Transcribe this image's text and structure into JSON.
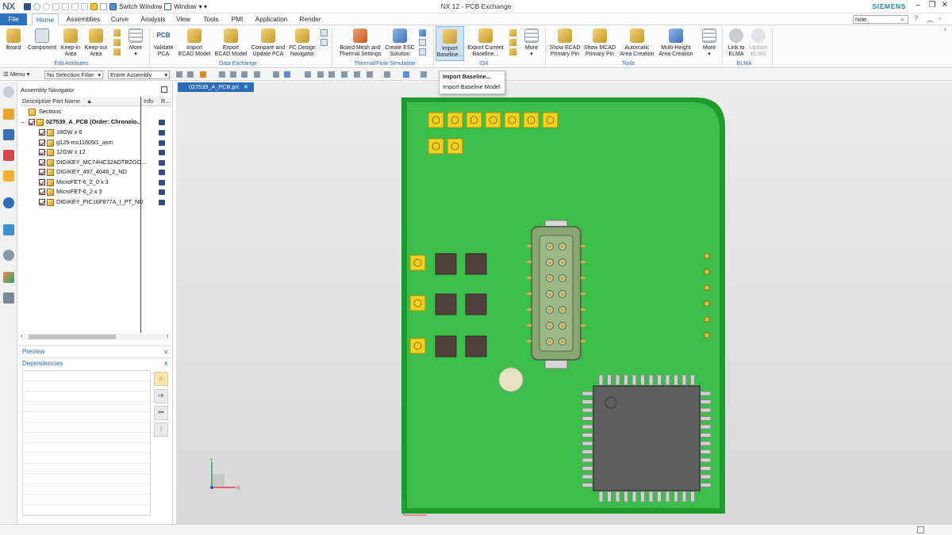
{
  "app": {
    "logo": "NX",
    "window_title": "NX 12 - PCB Exchange",
    "brand": "SIEMENS",
    "switch_window": "Switch Window",
    "window_menu": "Window"
  },
  "menu": {
    "tabs": [
      "File",
      "Home",
      "Assemblies",
      "Curve",
      "Analysis",
      "View",
      "Tools",
      "PMI",
      "Application",
      "Render"
    ],
    "active": "Home",
    "search_value": "hole"
  },
  "ribbon": {
    "edit_attributes": {
      "group": "Edit Attributes",
      "board": "Board",
      "component": "Component",
      "keepin": [
        "Keep-in",
        "Area"
      ],
      "keepout": [
        "Keep-out",
        "Area"
      ],
      "more": "More"
    },
    "data_exchange": {
      "group": "Data Exchange",
      "validate": [
        "Validate",
        "PCA"
      ],
      "import_ecad": [
        "Import",
        "ECAD Model"
      ],
      "export_ecad": [
        "Export",
        "ECAD Model"
      ],
      "compare": [
        "Compare and",
        "Update PCA"
      ],
      "pc_design": [
        "PC Design",
        "Navigator"
      ],
      "pcb_label": "PCB"
    },
    "thermal": {
      "group": "Thermal/Flow Simulation",
      "board_mesh": [
        "Board Mesh and",
        "Thermal Settings"
      ],
      "create_esc": [
        "Create ESC",
        "Solution"
      ]
    },
    "idx": {
      "group": "IDX",
      "import_baseline": [
        "Import",
        "Baseline..."
      ],
      "export_current": [
        "Export Current",
        "Baseline..."
      ],
      "more": "More"
    },
    "tools": {
      "group": "Tools",
      "show_ecad": [
        "Show ECAD",
        "Primary Pin"
      ],
      "show_mcad": [
        "Show MCAD",
        "Primary Pin"
      ],
      "automatic": [
        "Automatic",
        "Area Creation"
      ],
      "multi_height": [
        "Multi-Height",
        "Area Creation"
      ],
      "more": "More"
    },
    "elma": {
      "group": "ELMA",
      "link": [
        "Link to",
        "ELMA"
      ],
      "update": [
        "Update",
        "ELMA"
      ]
    }
  },
  "dropdown": {
    "items": [
      "Import Baseline...",
      "Import Baseline Model"
    ]
  },
  "toolbar2": {
    "menu": "Menu",
    "filter": "No Selection Filter",
    "scope": "Entire Assembly"
  },
  "navigator": {
    "title": "Assembly Navigator",
    "columns": {
      "name": "Descriptive Part Name",
      "info": "Info",
      "r": "R..."
    },
    "rows": [
      {
        "label": "Sections",
        "level": 0,
        "type": "folder"
      },
      {
        "label": "027539_A_PCB (Order: Chronolo...",
        "level": 0,
        "type": "assembly",
        "bold": true
      },
      {
        "label": "18GW x 6",
        "level": 1,
        "type": "part"
      },
      {
        "label": "g125-ms11605l1_asm",
        "level": 1,
        "type": "part"
      },
      {
        "label": "12GW x 12",
        "level": 1,
        "type": "part"
      },
      {
        "label": "DIGIKEY_MC74HC32ADTR2GO...",
        "level": 1,
        "type": "part"
      },
      {
        "label": "DIGIKEY_497_4048_2_ND",
        "level": 1,
        "type": "part"
      },
      {
        "label": "MicroFET-6_2_0 x 3",
        "level": 1,
        "type": "part"
      },
      {
        "label": "MicroFET-6_2 x 3",
        "level": 1,
        "type": "part"
      },
      {
        "label": "DIGIKEY_PIC16F877A_I_PT_ND",
        "level": 1,
        "type": "part"
      }
    ],
    "preview": "Preview",
    "dependencies": "Dependencies"
  },
  "viewport": {
    "doc_tab": "027539_A_PCB.prt",
    "axis_x": "X",
    "axis_y": "Y",
    "board_color": "#3cbf4a",
    "board_edge": "#1f9a2c",
    "pad_color": "#f2d21d"
  }
}
